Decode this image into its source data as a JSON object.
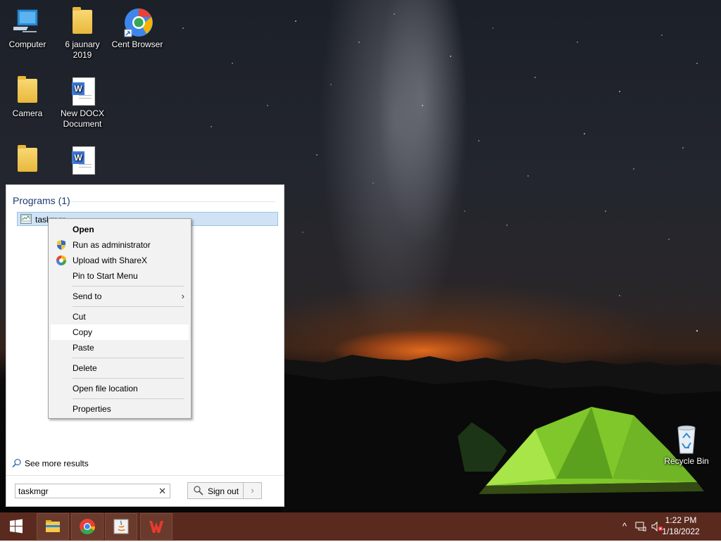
{
  "desktop": {
    "icons": [
      {
        "label": "Computer"
      },
      {
        "label": "6 jaunary 2019"
      },
      {
        "label": "Cent Browser"
      },
      {
        "label": "Camera"
      },
      {
        "label": "New DOCX Document"
      },
      {
        "label": ""
      },
      {
        "label": ""
      },
      {
        "label": "Recycle Bin"
      }
    ]
  },
  "start_menu": {
    "section_header": "Programs (1)",
    "program_item": "taskmgr",
    "see_more": "See more results",
    "search_value": "taskmgr",
    "clear_glyph": "✕",
    "signout_label": "Sign out",
    "signout_arrow": "›"
  },
  "context_menu": {
    "items": [
      {
        "label": "Open",
        "icon": "none",
        "bold": true
      },
      {
        "label": "Run as administrator",
        "icon": "shield-icon"
      },
      {
        "label": "Upload with ShareX",
        "icon": "sharex-icon"
      },
      {
        "label": "Pin to Start Menu",
        "icon": "none"
      },
      {
        "label": "Send to",
        "icon": "none",
        "submenu": true
      },
      {
        "label": "Cut",
        "icon": "none"
      },
      {
        "label": "Copy",
        "icon": "none",
        "highlighted": true
      },
      {
        "label": "Paste",
        "icon": "none"
      },
      {
        "label": "Delete",
        "icon": "none"
      },
      {
        "label": "Open file location",
        "icon": "none"
      },
      {
        "label": "Properties",
        "icon": "none"
      }
    ],
    "submenu_arrow": "›"
  },
  "taskbar": {
    "apps": [
      "file-explorer-icon",
      "chrome-icon",
      "java-icon",
      "wps-office-icon"
    ],
    "tray": {
      "chevron": "^",
      "time": "1:22 PM",
      "date": "1/18/2022"
    }
  },
  "colors": {
    "taskbar": "#5a2a1f",
    "selection": "#cfe3f5",
    "header_text": "#1e3b70"
  }
}
